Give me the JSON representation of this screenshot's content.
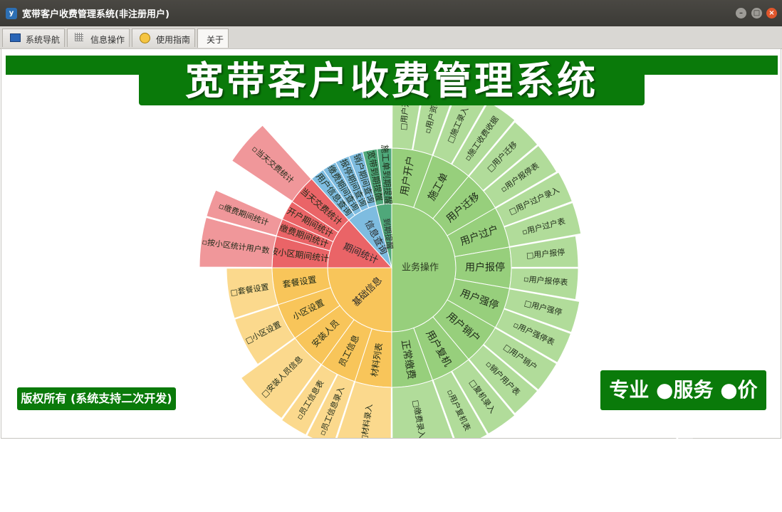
{
  "window": {
    "title": "宽带客户收费管理系统(非注册用户)",
    "icon": "app-logo-icon",
    "controls": [
      "minimize-icon",
      "maximize-icon",
      "close-icon"
    ]
  },
  "tabs": [
    {
      "label": "系统导航",
      "icon": "monitor-icon"
    },
    {
      "label": "信息操作",
      "icon": "grid-icon"
    },
    {
      "label": "使用指南",
      "icon": "guide-icon"
    },
    {
      "label": "关于",
      "icon": ""
    }
  ],
  "active_tab": 3,
  "banner": {
    "title": "宽带客户收费管理系统"
  },
  "footer": {
    "copyright": "版权所有 (系统支持二次开发)",
    "slogan": "专业 ●服务 ●价值"
  },
  "colors": {
    "accent_green": "#0a7a0a",
    "business": "#97cf7c",
    "business_light": "#b1dc9a",
    "business_dark": "#77b85a",
    "basic": "#f8c55a",
    "basic_light": "#fbd98d",
    "period": "#ea6467",
    "period_light": "#f0979a",
    "query": "#7ebce0",
    "query_light": "#a0cfea",
    "reminder": "#4fa87a",
    "reminder_light": "#7cc49f"
  },
  "sunburst": {
    "categories": [
      {
        "name": "业务操作",
        "color": "business",
        "children": [
          {
            "name": "用户开户",
            "items": [
              "□用户开户",
              "▫用户资料"
            ]
          },
          {
            "name": "施工单",
            "items": [
              "□施工录入",
              "▫施工收费收据"
            ]
          },
          {
            "name": "用户迁移",
            "items": [
              "□用户迁移",
              "▫用户报停表"
            ]
          },
          {
            "name": "用户过户",
            "items": [
              "□用户过户录入",
              "▫用户过户表"
            ]
          },
          {
            "name": "用户报停",
            "items": [
              "□用户报停",
              "▫用户报停表"
            ]
          },
          {
            "name": "用户强停",
            "items": [
              "□用户强停",
              "▫用户强停表"
            ]
          },
          {
            "name": "用户销户",
            "items": [
              "□用户销户",
              "▫销户用户表"
            ]
          },
          {
            "name": "用户复机",
            "items": [
              "□复机录入",
              "▫用户复机表"
            ]
          },
          {
            "name": "正常缴费",
            "items": [
              "□缴费录入"
            ]
          }
        ]
      },
      {
        "name": "基础信息",
        "color": "basic",
        "children": [
          {
            "name": "材料列表",
            "items": [
              "□材料录入"
            ]
          },
          {
            "name": "员工信息",
            "items": [
              "▫员工信息录入",
              "▫员工信息表"
            ]
          },
          {
            "name": "安装人员",
            "items": [
              "□安装人员信息"
            ]
          },
          {
            "name": "小区设置",
            "items": [
              "□小区设置"
            ]
          },
          {
            "name": "套餐设置",
            "items": [
              "□套餐设置"
            ]
          }
        ]
      },
      {
        "name": "期间统计",
        "color": "period",
        "children": [
          {
            "name": "按小区期间统计",
            "items": [
              "▫按小区统计用户数"
            ]
          },
          {
            "name": "缴费期间统计",
            "items": [
              "▫缴费期间统计"
            ]
          },
          {
            "name": "开户期间统计",
            "items": []
          },
          {
            "name": "当天交费统计",
            "items": [
              "▫当天交费统计"
            ]
          }
        ]
      },
      {
        "name": "信息查询",
        "color": "query",
        "children": [
          {
            "name": "用户信息查询",
            "items": []
          },
          {
            "name": "缴费期间查询",
            "items": []
          },
          {
            "name": "报停期间查询",
            "items": []
          },
          {
            "name": "销户期间查询",
            "items": []
          }
        ]
      },
      {
        "name": "到期提醒",
        "color": "reminder",
        "children": [
          {
            "name": "宽带到期提醒",
            "items": []
          },
          {
            "name": "施工单到期提醒",
            "items": []
          }
        ]
      }
    ]
  }
}
